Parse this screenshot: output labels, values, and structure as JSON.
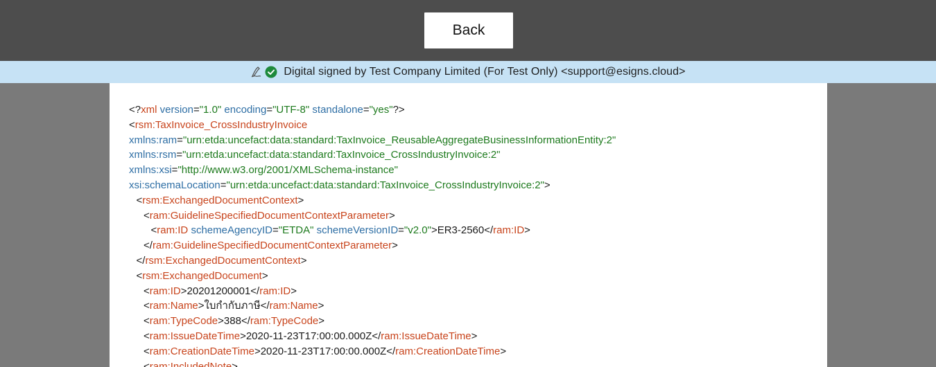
{
  "toolbar": {
    "back_label": "Back"
  },
  "signature": {
    "text": "Digital signed by Test Company Limited (For Test Only) <support@esigns.cloud>",
    "icons": [
      "signature-pen-icon",
      "check-circle-icon"
    ],
    "colors": {
      "bar": "#c6e2f5",
      "check": "#1e8a3c"
    }
  },
  "document": {
    "colors": {
      "tag": "#c8441c",
      "attribute": "#2f6fa5",
      "value": "#1d7a1d",
      "text": "#1a1a1a"
    },
    "lines": [
      {
        "indent": 0,
        "parts": [
          [
            "p",
            "<?"
          ],
          [
            "t",
            "xml"
          ],
          [
            "p",
            " "
          ],
          [
            "a",
            "version"
          ],
          [
            "p",
            "="
          ],
          [
            "v",
            "\"1.0\""
          ],
          [
            "p",
            " "
          ],
          [
            "a",
            "encoding"
          ],
          [
            "p",
            "="
          ],
          [
            "v",
            "\"UTF-8\""
          ],
          [
            "p",
            " "
          ],
          [
            "a",
            "standalone"
          ],
          [
            "p",
            "="
          ],
          [
            "v",
            "\"yes\""
          ],
          [
            "p",
            "?>"
          ]
        ]
      },
      {
        "indent": 0,
        "parts": [
          [
            "p",
            "<"
          ],
          [
            "t",
            "rsm:TaxInvoice_CrossIndustryInvoice"
          ]
        ]
      },
      {
        "indent": 0,
        "parts": [
          [
            "a",
            "xmlns:ram"
          ],
          [
            "p",
            "="
          ],
          [
            "v",
            "\"urn:etda:uncefact:data:standard:TaxInvoice_ReusableAggregateBusinessInformationEntity:2\""
          ]
        ]
      },
      {
        "indent": 0,
        "parts": [
          [
            "a",
            "xmlns:rsm"
          ],
          [
            "p",
            "="
          ],
          [
            "v",
            "\"urn:etda:uncefact:data:standard:TaxInvoice_CrossIndustryInvoice:2\""
          ]
        ]
      },
      {
        "indent": 0,
        "parts": [
          [
            "a",
            "xmlns:xsi"
          ],
          [
            "p",
            "="
          ],
          [
            "v",
            "\"http://www.w3.org/2001/XMLSchema-instance\""
          ]
        ]
      },
      {
        "indent": 0,
        "parts": [
          [
            "a",
            "xsi:schemaLocation"
          ],
          [
            "p",
            "="
          ],
          [
            "v",
            "\"urn:etda:uncefact:data:standard:TaxInvoice_CrossIndustryInvoice:2\""
          ],
          [
            "p",
            ">"
          ]
        ]
      },
      {
        "indent": 1,
        "parts": [
          [
            "p",
            "<"
          ],
          [
            "t",
            "rsm:ExchangedDocumentContext"
          ],
          [
            "p",
            ">"
          ]
        ]
      },
      {
        "indent": 2,
        "parts": [
          [
            "p",
            "<"
          ],
          [
            "t",
            "ram:GuidelineSpecifiedDocumentContextParameter"
          ],
          [
            "p",
            ">"
          ]
        ]
      },
      {
        "indent": 3,
        "parts": [
          [
            "p",
            "<"
          ],
          [
            "t",
            "ram:ID"
          ],
          [
            "p",
            " "
          ],
          [
            "a",
            "schemeAgencyID"
          ],
          [
            "p",
            "="
          ],
          [
            "v",
            "\"ETDA\""
          ],
          [
            "p",
            " "
          ],
          [
            "a",
            "schemeVersionID"
          ],
          [
            "p",
            "="
          ],
          [
            "v",
            "\"v2.0\""
          ],
          [
            "p",
            ">ER3-2560</"
          ],
          [
            "t",
            "ram:ID"
          ],
          [
            "p",
            ">"
          ]
        ]
      },
      {
        "indent": 2,
        "parts": [
          [
            "p",
            "</"
          ],
          [
            "t",
            "ram:GuidelineSpecifiedDocumentContextParameter"
          ],
          [
            "p",
            ">"
          ]
        ]
      },
      {
        "indent": 1,
        "parts": [
          [
            "p",
            "</"
          ],
          [
            "t",
            "rsm:ExchangedDocumentContext"
          ],
          [
            "p",
            ">"
          ]
        ]
      },
      {
        "indent": 1,
        "parts": [
          [
            "p",
            "<"
          ],
          [
            "t",
            "rsm:ExchangedDocument"
          ],
          [
            "p",
            ">"
          ]
        ]
      },
      {
        "indent": 2,
        "parts": [
          [
            "p",
            "<"
          ],
          [
            "t",
            "ram:ID"
          ],
          [
            "p",
            ">20201200001</"
          ],
          [
            "t",
            "ram:ID"
          ],
          [
            "p",
            ">"
          ]
        ]
      },
      {
        "indent": 2,
        "parts": [
          [
            "p",
            "<"
          ],
          [
            "t",
            "ram:Name"
          ],
          [
            "p",
            ">ใบกำกับภาษี</"
          ],
          [
            "t",
            "ram:Name"
          ],
          [
            "p",
            ">"
          ]
        ]
      },
      {
        "indent": 2,
        "parts": [
          [
            "p",
            "<"
          ],
          [
            "t",
            "ram:TypeCode"
          ],
          [
            "p",
            ">388</"
          ],
          [
            "t",
            "ram:TypeCode"
          ],
          [
            "p",
            ">"
          ]
        ]
      },
      {
        "indent": 2,
        "parts": [
          [
            "p",
            "<"
          ],
          [
            "t",
            "ram:IssueDateTime"
          ],
          [
            "p",
            ">2020-11-23T17:00:00.000Z</"
          ],
          [
            "t",
            "ram:IssueDateTime"
          ],
          [
            "p",
            ">"
          ]
        ]
      },
      {
        "indent": 2,
        "parts": [
          [
            "p",
            "<"
          ],
          [
            "t",
            "ram:CreationDateTime"
          ],
          [
            "p",
            ">2020-11-23T17:00:00.000Z</"
          ],
          [
            "t",
            "ram:CreationDateTime"
          ],
          [
            "p",
            ">"
          ]
        ]
      },
      {
        "indent": 2,
        "parts": [
          [
            "p",
            "<"
          ],
          [
            "t",
            "ram:IncludedNote"
          ],
          [
            "p",
            ">"
          ]
        ]
      }
    ]
  }
}
